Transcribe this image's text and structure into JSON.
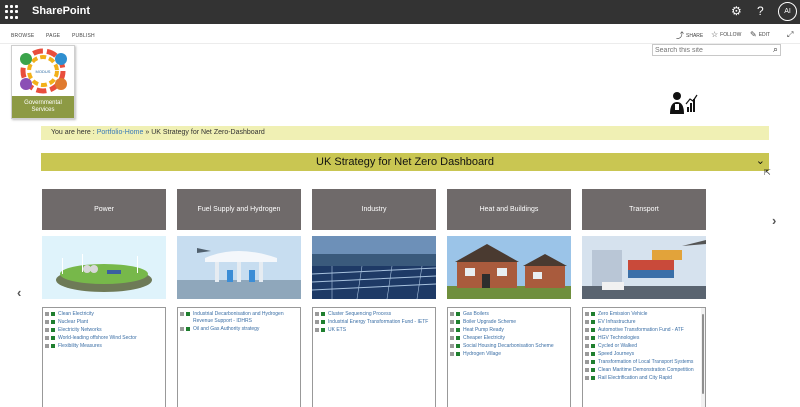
{
  "suitebar": {
    "brand": "SharePoint",
    "avatar": "AI"
  },
  "ribbon": {
    "tabs": [
      "BROWSE",
      "PAGE",
      "PUBLISH"
    ],
    "actions": {
      "share": "SHARE",
      "follow": "FOLLOW",
      "edit": "EDIT"
    }
  },
  "search": {
    "placeholder": "Search this site"
  },
  "logo": {
    "small_text": "MODUS",
    "caption_line1": "Governmental",
    "caption_line2": "Services"
  },
  "breadcrumb": {
    "prefix": "You are here :",
    "home": "Portfolio-Home",
    "sep": "»",
    "current": "UK Strategy for Net Zero-Dashboard"
  },
  "banner": {
    "title": "UK Strategy for Net Zero Dashboard"
  },
  "categories": [
    {
      "title": "Power",
      "items": [
        "Clean Electricity",
        "Nuclear Plant",
        "Electricity Networks",
        "World-leading offshore Wind Sector",
        "Flexibility Measures"
      ]
    },
    {
      "title": "Fuel Supply and Hydrogen",
      "items": [
        "Industrial Decarbonisation and Hydrogen Revenue Support - IDHRS",
        "Oil and Gas Authority strategy"
      ]
    },
    {
      "title": "Industry",
      "items": [
        "Cluster Sequencing Process",
        "Industrial Energy Transformation Fund - IETF",
        "UK ETS"
      ]
    },
    {
      "title": "Heat and Buildings",
      "items": [
        "Gas Boilers",
        "Boiler Upgrade Scheme",
        "Heat Pump Ready",
        "Cheaper Electricity",
        "Social Housing Decarbonisation Scheme",
        "Hydrogen Village"
      ]
    },
    {
      "title": "Transport",
      "items": [
        "Zero Emission Vehicle",
        "EV Infrastructure",
        "Automotive Transformation Fund - ATF",
        "HGV Technologies",
        "Cycled or Walked",
        "Speed Journeys",
        "Transformation of Local Transport Systems",
        "Clean Maritime Demonstration Competition",
        "Rail Electrification and City Rapid"
      ]
    }
  ],
  "colors": {
    "suitebar": "#333333",
    "banner": "#c9c652",
    "breadcrumb": "#f0f0b4",
    "tile": "#6f6a6a",
    "link": "#3a6ea5"
  }
}
